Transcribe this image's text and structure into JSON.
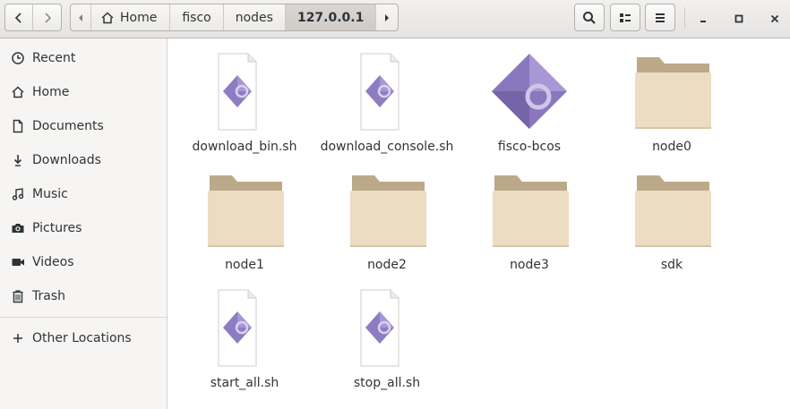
{
  "header": {
    "breadcrumbs": [
      "Home",
      "fisco",
      "nodes",
      "127.0.0.1"
    ],
    "current": "127.0.0.1"
  },
  "sidebar": {
    "items": [
      {
        "label": "Recent",
        "icon": "clock-icon"
      },
      {
        "label": "Home",
        "icon": "home-icon"
      },
      {
        "label": "Documents",
        "icon": "document-icon"
      },
      {
        "label": "Downloads",
        "icon": "download-icon"
      },
      {
        "label": "Music",
        "icon": "music-icon"
      },
      {
        "label": "Pictures",
        "icon": "camera-icon"
      },
      {
        "label": "Videos",
        "icon": "video-icon"
      },
      {
        "label": "Trash",
        "icon": "trash-icon"
      },
      {
        "label": "Other Locations",
        "icon": "plus-icon"
      }
    ]
  },
  "files": [
    {
      "name": "download_bin.sh",
      "kind": "script"
    },
    {
      "name": "download_console.sh",
      "kind": "script"
    },
    {
      "name": "fisco-bcos",
      "kind": "executable"
    },
    {
      "name": "node0",
      "kind": "folder"
    },
    {
      "name": "node1",
      "kind": "folder"
    },
    {
      "name": "node2",
      "kind": "folder"
    },
    {
      "name": "node3",
      "kind": "folder"
    },
    {
      "name": "sdk",
      "kind": "folder"
    },
    {
      "name": "start_all.sh",
      "kind": "script"
    },
    {
      "name": "stop_all.sh",
      "kind": "script"
    }
  ],
  "colors": {
    "folder_tab": "#bba98a",
    "folder_body": "#ecdcc2",
    "script_purple": "#8e7cc3"
  }
}
